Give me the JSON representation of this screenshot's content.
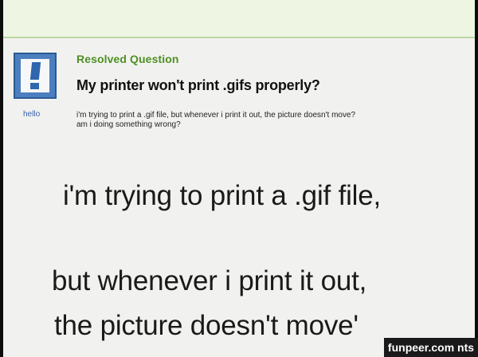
{
  "question": {
    "status": "Resolved Question",
    "title": "My printer won't print .gifs properly?",
    "body_lines": [
      "i'm trying to print a .gif file, but whenever i print it out, the picture doesn't move?",
      "am i doing something wrong?"
    ],
    "asker": "hello",
    "avatar_icon": "exclamation-icon"
  },
  "zoomed_text": {
    "line1": "i'm trying to print a .gif file,",
    "line2": "but whenever i print it out,",
    "line3": "the picture doesn't move'"
  },
  "watermark": "funpeer.com nts",
  "colors": {
    "status_green": "#4e8f25",
    "avatar_blue": "#4b7fbf",
    "username_blue": "#3b5ea8"
  }
}
